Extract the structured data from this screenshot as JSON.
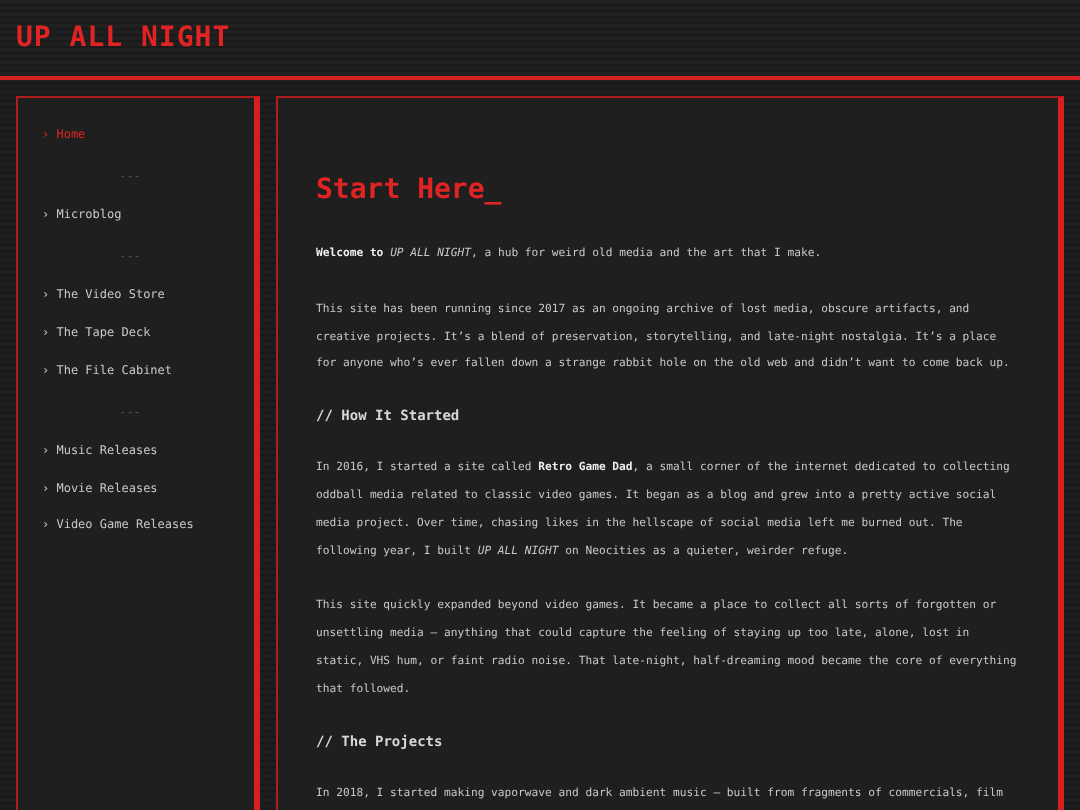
{
  "site_title": "UP ALL NIGHT",
  "sidebar": {
    "items": [
      {
        "kind": "link",
        "label": "› Home",
        "selected": true
      },
      {
        "kind": "separator",
        "label": "---"
      },
      {
        "kind": "link",
        "label": "› Microblog",
        "selected": false
      },
      {
        "kind": "separator",
        "label": "---"
      },
      {
        "kind": "link",
        "label": "› The Video Store",
        "selected": false
      },
      {
        "kind": "link",
        "label": "› The Tape Deck",
        "selected": false
      },
      {
        "kind": "link",
        "label": "› The File Cabinet",
        "selected": false
      },
      {
        "kind": "separator",
        "label": "---"
      },
      {
        "kind": "link",
        "label": "› Music Releases",
        "selected": false
      },
      {
        "kind": "link",
        "label": "› Movie Releases",
        "selected": false
      },
      {
        "kind": "link",
        "label": "› Video Game Releases",
        "selected": false
      }
    ]
  },
  "main": {
    "heading": "Start Here_",
    "blocks": [
      {
        "kind": "paragraph",
        "text": "**Welcome to** *UP ALL NIGHT*, a hub for weird old media and the art that I make."
      },
      {
        "kind": "paragraph",
        "text": "This site has been running since 2017 as an ongoing archive of lost media, obscure artifacts, and creative projects. It’s a blend of preservation, storytelling, and late-night nostalgia. It’s a place for anyone who’s ever fallen down a strange rabbit hole on the old web and didn’t want to come back up."
      },
      {
        "kind": "subheading",
        "text": "// How It Started"
      },
      {
        "kind": "paragraph",
        "text": "In 2016, I started a site called **Retro Game Dad**, a small corner of the internet dedicated to collecting oddball media related to classic video games. It began as a blog and grew into a pretty active social media project. Over time, chasing likes in the hellscape of social media left me burned out. The following year, I built *UP ALL NIGHT* on Neocities as a quieter, weirder refuge."
      },
      {
        "kind": "paragraph",
        "text": "This site quickly expanded beyond video games. It became a place to collect all sorts of forgotten or unsettling media – anything that could capture the feeling of staying up too late, alone, lost in static, VHS hum, or faint radio noise. That late-night, half-dreaming mood became the core of everything that followed."
      },
      {
        "kind": "subheading",
        "text": "// The Projects"
      },
      {
        "kind": "paragraph",
        "text": "In 2018, I started making vaporwave and dark ambient music – built from fragments of commercials, film"
      }
    ]
  }
}
